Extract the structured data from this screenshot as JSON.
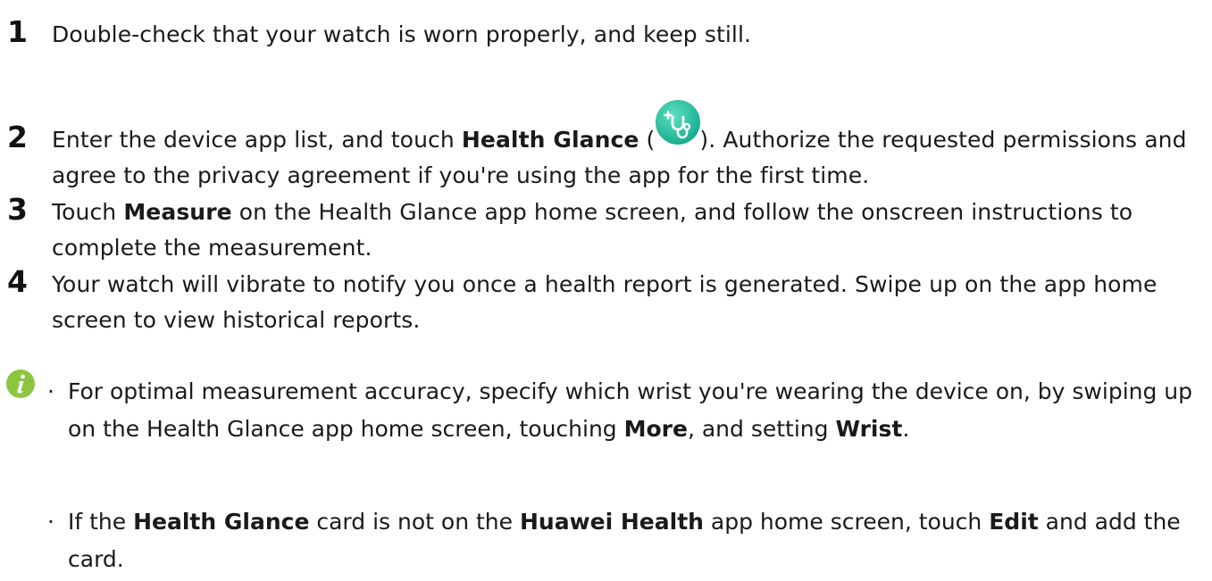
{
  "steps": [
    {
      "number": "1",
      "text": "Double-check that your watch is worn properly, and keep still."
    },
    {
      "number": "2",
      "part1": "Enter the device app list, and touch ",
      "bold1": "Health Glance",
      "part2": " (",
      "part3": "). Authorize the requested permissions and agree to the privacy agreement if you're using the app for the first time.",
      "icon": "health-glance-app-icon"
    },
    {
      "number": "3",
      "part1": "Touch ",
      "bold1": "Measure",
      "part2": " on the Health Glance app home screen, and follow the onscreen instructions to complete the measurement."
    },
    {
      "number": "4",
      "text": "Your watch will vibrate to notify you once a health report is generated. Swipe up on the app home screen to view historical reports."
    }
  ],
  "notes": {
    "icon": "info-icon",
    "bullet_char": "·",
    "items": [
      {
        "part1": "For optimal measurement accuracy, specify which wrist you're wearing the device on, by swiping up on the Health Glance app home screen, touching ",
        "bold1": "More",
        "part2": ", and setting ",
        "bold2": "Wrist",
        "part3": "."
      },
      {
        "part1": "If the ",
        "bold1": "Health Glance",
        "part2": " card is not on the ",
        "bold2": "Huawei Health",
        "part3": " app home screen, touch ",
        "bold3": "Edit",
        "part4": " and add the card."
      }
    ]
  },
  "colors": {
    "icon_teal": "#2ec4a6",
    "info_green": "#8cc63f"
  }
}
